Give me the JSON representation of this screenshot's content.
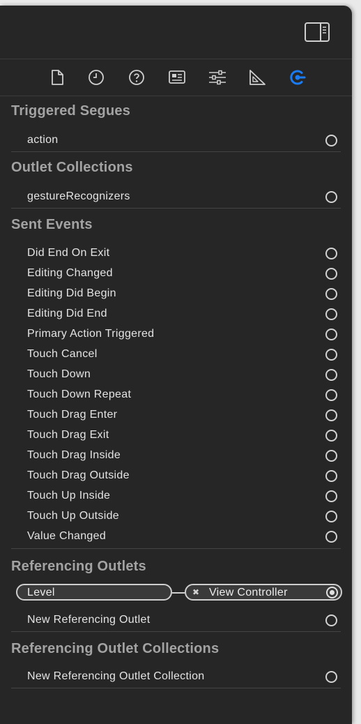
{
  "accent_color": "#1a7cf5",
  "tabs": [
    {
      "name": "file-inspector",
      "icon": "file-icon"
    },
    {
      "name": "history-inspector",
      "icon": "clock-icon"
    },
    {
      "name": "quick-help",
      "icon": "question-icon"
    },
    {
      "name": "identity-inspector",
      "icon": "id-card-icon"
    },
    {
      "name": "attributes-inspector",
      "icon": "sliders-icon"
    },
    {
      "name": "size-inspector",
      "icon": "ruler-icon"
    },
    {
      "name": "connections-inspector",
      "icon": "connections-icon",
      "active": true
    }
  ],
  "triggered_segues": {
    "title": "Triggered Segues",
    "items": [
      "action"
    ]
  },
  "outlet_collections": {
    "title": "Outlet Collections",
    "items": [
      "gestureRecognizers"
    ]
  },
  "sent_events": {
    "title": "Sent Events",
    "items": [
      "Did End On Exit",
      "Editing Changed",
      "Editing Did Begin",
      "Editing Did End",
      "Primary Action Triggered",
      "Touch Cancel",
      "Touch Down",
      "Touch Down Repeat",
      "Touch Drag Enter",
      "Touch Drag Exit",
      "Touch Drag Inside",
      "Touch Drag Outside",
      "Touch Up Inside",
      "Touch Up Outside",
      "Value Changed"
    ]
  },
  "referencing_outlets": {
    "title": "Referencing Outlets",
    "connection": {
      "outlet": "Level",
      "remove_glyph": "✖",
      "target": "View Controller"
    },
    "new_label": "New Referencing Outlet"
  },
  "referencing_outlet_collections": {
    "title": "Referencing Outlet Collections",
    "new_label": "New Referencing Outlet Collection"
  }
}
